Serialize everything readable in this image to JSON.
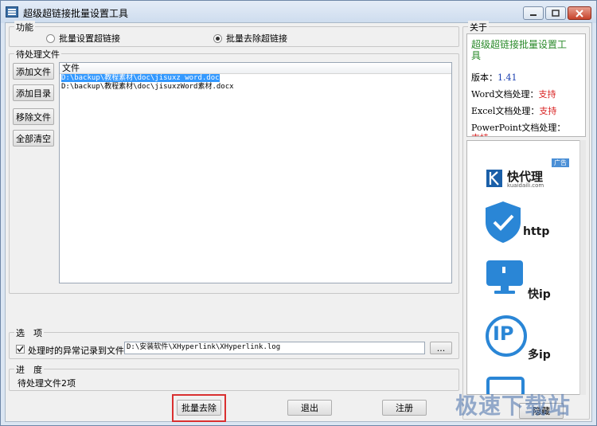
{
  "window": {
    "title": "超级超链接批量设置工具"
  },
  "function_group": {
    "label": "功能",
    "options": [
      {
        "label": "批量设置超链接",
        "selected": false
      },
      {
        "label": "批量去除超链接",
        "selected": true
      }
    ]
  },
  "pending_group": {
    "label": "待处理文件",
    "buttons": [
      "添加文件",
      "添加目录",
      "移除文件",
      "全部清空"
    ],
    "column_header": "文件",
    "files": [
      "D:\\backup\\教程素材\\doc\\jisuxz word.doc",
      "D:\\backup\\教程素材\\doc\\jisuxzWord素材.docx"
    ]
  },
  "options_group": {
    "label": "选　项",
    "log_checkbox_label": "处理时的异常记录到文件:",
    "log_checked": true,
    "log_path": "D:\\安装软件\\XHyperlink\\XHyperlink.log",
    "browse_label": "..."
  },
  "progress_group": {
    "label": "进　度",
    "status": "待处理文件2项"
  },
  "bottom_buttons": {
    "batch_remove": "批量去除",
    "exit": "退出",
    "register": "注册",
    "hide_partial": "隐藏"
  },
  "about_group": {
    "label": "关于",
    "app_name": "超级超链接批量设置工具",
    "version_label": "版本：",
    "version_value": "1.41",
    "word_label": "Word文档处理：",
    "word_value": "支持",
    "excel_label": "Excel文档处理：",
    "excel_value": "支持",
    "ppt_label": "PowerPoint文档处理：",
    "ppt_value": "支持"
  },
  "ad": {
    "badge": "广告",
    "brand": "快代理",
    "domain": "kuaidaili.com",
    "labels": [
      "http",
      "快ip",
      "多ip"
    ],
    "ip_text": "IP"
  },
  "watermark": "极速下载站",
  "colors": {
    "accent_red": "#d81e1e",
    "about_green": "#2a8a2a",
    "selection": "#3399ff",
    "ad_blue": "#2a86d6"
  }
}
